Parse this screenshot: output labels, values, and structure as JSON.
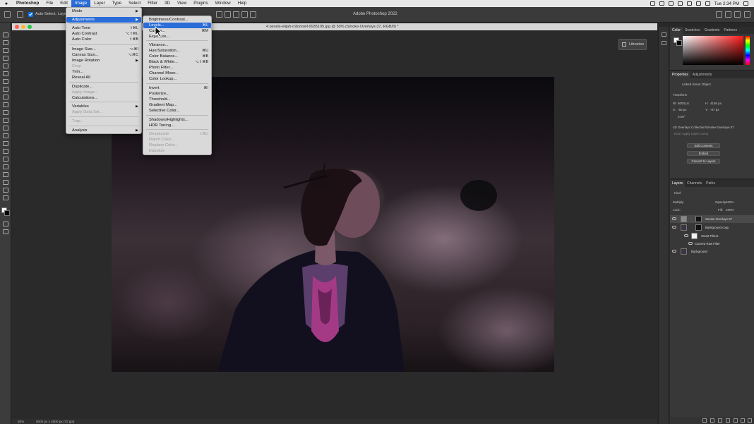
{
  "menubar": {
    "apple": "",
    "items": [
      "Photoshop",
      "File",
      "Edit",
      "Image",
      "Layer",
      "Type",
      "Select",
      "Filter",
      "3D",
      "View",
      "Plugins",
      "Window",
      "Help"
    ],
    "active": "Image",
    "clock": "Tue 2:34 PM"
  },
  "optionsbar": {
    "auto_select": "Auto-Select:",
    "layer_select": "Layer",
    "app_title": "Adobe Photoshop 2022"
  },
  "document": {
    "tab_title": "4 pexels-elijah-o'donnell-9935195.jpg @ 50% (Smoke-Overlays-37, RGB/8) *",
    "libraries_label": "Libraries"
  },
  "statusbar": {
    "zoom": "50%",
    "size": "6000 px x 4000 px (72 ppi)"
  },
  "image_menu": {
    "items": [
      {
        "label": "Mode",
        "submenu": true
      },
      {
        "label": "Adjustments",
        "submenu": true,
        "highlight": true
      },
      {
        "label": "Auto Tone",
        "shortcut": "⇧⌘L"
      },
      {
        "label": "Auto Contrast",
        "shortcut": "⌥⇧⌘L"
      },
      {
        "label": "Auto Color",
        "shortcut": "⇧⌘B"
      },
      {
        "label": "Image Size...",
        "shortcut": "⌥⌘I"
      },
      {
        "label": "Canvas Size...",
        "shortcut": "⌥⌘C"
      },
      {
        "label": "Image Rotation",
        "submenu": true
      },
      {
        "label": "Crop",
        "disabled": true
      },
      {
        "label": "Trim..."
      },
      {
        "label": "Reveal All"
      },
      {
        "label": "Duplicate..."
      },
      {
        "label": "Apply Image...",
        "disabled": true
      },
      {
        "label": "Calculations..."
      },
      {
        "label": "Variables",
        "submenu": true
      },
      {
        "label": "Apply Data Set...",
        "disabled": true
      },
      {
        "label": "Trap...",
        "disabled": true
      },
      {
        "label": "Analysis",
        "submenu": true
      }
    ]
  },
  "adjustments_menu": {
    "items": [
      {
        "label": "Brightness/Contrast..."
      },
      {
        "label": "Levels...",
        "shortcut": "⌘L",
        "highlight": true
      },
      {
        "label": "Curves...",
        "shortcut": "⌘M"
      },
      {
        "label": "Exposure..."
      },
      {
        "label": "Vibrance..."
      },
      {
        "label": "Hue/Saturation...",
        "shortcut": "⌘U"
      },
      {
        "label": "Color Balance...",
        "shortcut": "⌘B"
      },
      {
        "label": "Black & White...",
        "shortcut": "⌥⇧⌘B"
      },
      {
        "label": "Photo Filter..."
      },
      {
        "label": "Channel Mixer..."
      },
      {
        "label": "Color Lookup..."
      },
      {
        "label": "Invert",
        "shortcut": "⌘I"
      },
      {
        "label": "Posterize..."
      },
      {
        "label": "Threshold..."
      },
      {
        "label": "Gradient Map..."
      },
      {
        "label": "Selective Color..."
      },
      {
        "label": "Shadows/Highlights..."
      },
      {
        "label": "HDR Toning..."
      },
      {
        "label": "Desaturate",
        "shortcut": "⇧⌘U",
        "disabled": true
      },
      {
        "label": "Match Color...",
        "disabled": true
      },
      {
        "label": "Replace Color...",
        "disabled": true
      },
      {
        "label": "Equalize",
        "disabled": true
      }
    ]
  },
  "color_panel": {
    "tabs": [
      "Color",
      "Swatches",
      "Gradients",
      "Patterns"
    ]
  },
  "properties_panel": {
    "tabs": [
      "Properties",
      "Adjustments"
    ],
    "object_type": "Linked Smart Object",
    "transform_label": "Transform",
    "w_label": "W:",
    "w_value": "6000 px",
    "h_label": "H:",
    "h_value": "4156 px",
    "x_label": "X:",
    "x_value": "-60 px",
    "y_label": "Y:",
    "y_value": "-87 px",
    "angle_value": "0.00°",
    "path": "4D Overlays Collection/Smoke-Overlays-37",
    "comps": "Don't Apply Layer Comp",
    "buttons": [
      "Edit Contents",
      "Embed",
      "Convert to Layers"
    ]
  },
  "layers_panel": {
    "tabs": [
      "Layers",
      "Channels",
      "Paths"
    ],
    "kind": "Kind",
    "blend_mode": "Multiply",
    "opacity_label": "Opacity:",
    "opacity_value": "100%",
    "lock_label": "Lock:",
    "fill_label": "Fill:",
    "fill_value": "100%",
    "layers": [
      {
        "name": "Smoke-Overlays-37",
        "selected": true
      },
      {
        "name": "Background copy"
      },
      {
        "name": "Smart Filters"
      },
      {
        "name": "Camera Raw Filter"
      },
      {
        "name": "Background"
      }
    ]
  }
}
